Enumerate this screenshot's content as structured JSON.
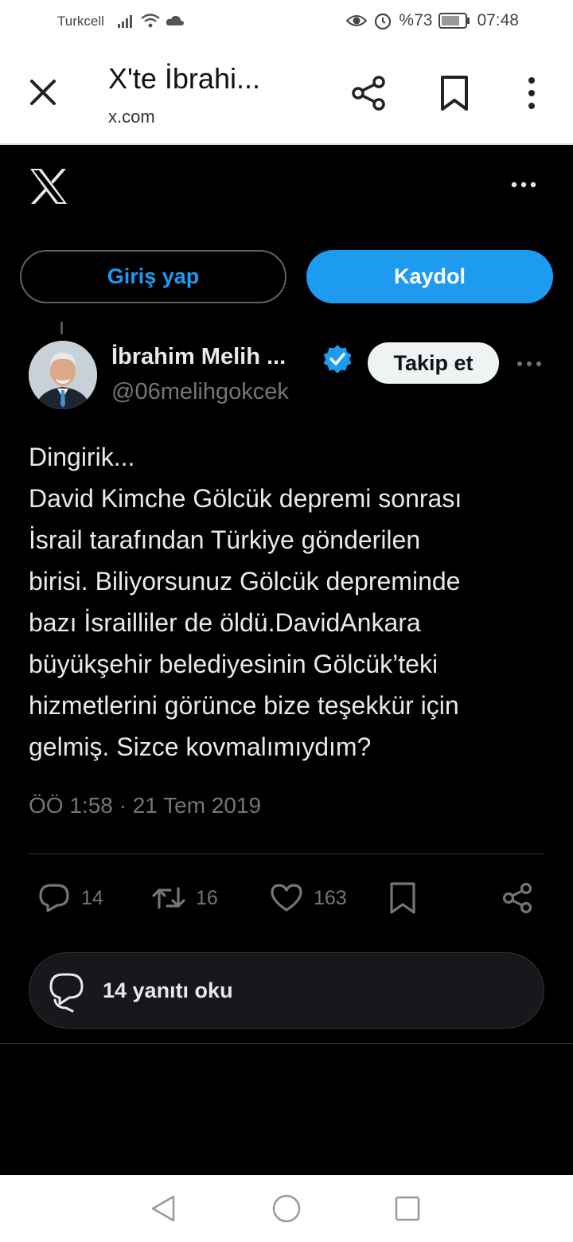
{
  "status_bar": {
    "carrier": "Turkcell",
    "battery": "%73",
    "time": "07:48"
  },
  "tab_bar": {
    "title": "X'te İbrahi...",
    "url": "x.com",
    "icons": [
      "close-icon",
      "share-icon",
      "bookmark-icon",
      "more-vert-icon"
    ]
  },
  "auth": {
    "login_label": "Giriş yap",
    "signup_label": "Kaydol"
  },
  "tweet": {
    "author_name": "İbrahim Melih ...",
    "handle": "@06melihgokcek",
    "follow_label": "Takip et",
    "text_lines": [
      "Dingirik...",
      "David Kimche Gölcük depremi sonrası",
      "İsrail tarafından Türkiye gönderilen",
      "birisi. Biliyorsunuz Gölcük depreminde",
      "bazı İsrailliler de öldü.DavidAnkara",
      "büyükşehir belediyesinin Gölcük’teki",
      "hizmetlerini görünce bize teşekkür için",
      "gelmiş. Sizce kovmalımıydım?"
    ],
    "timestamp": "ÖÖ 1:58 · 21 Tem 2019",
    "replies": "14",
    "reposts": "16",
    "likes": "163",
    "read_replies_label": "14 yanıtı oku"
  },
  "colors": {
    "accent": "#1d9bf0",
    "background": "#000000",
    "text": "#e7e9ea",
    "muted": "#71767b"
  }
}
